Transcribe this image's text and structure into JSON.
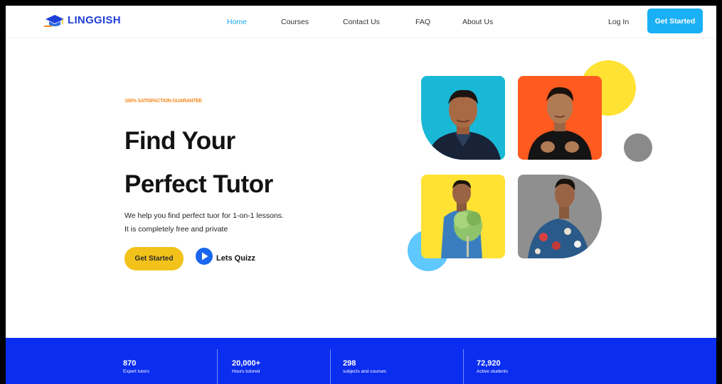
{
  "brand": {
    "name": "LINGGISH",
    "accent": "#1ab0f5",
    "primary": "#0a2df0",
    "yellow": "#f2c21b",
    "orange": "#f5891f"
  },
  "nav": {
    "links": [
      "Home",
      "Courses",
      "Contact Us",
      "FAQ",
      "About Us"
    ],
    "active": "Home",
    "login": "Log In",
    "cta": "Get Started"
  },
  "hero": {
    "eyebrow": "100% SATISFACTION GUARANTEE",
    "headline_1": "Find Your",
    "headline_2": "Perfect Tutor",
    "desc_1": "We help you find perfect tuor for 1-on-1 lessons.",
    "desc_2": "It is completely free and private",
    "cta": "Get Started",
    "secondary": "Lets Quizz",
    "secondary_icon": "play-icon"
  },
  "gallery": {
    "tiles": [
      {
        "bg": "#19b8d6",
        "shape": "photo-tutor-1"
      },
      {
        "bg": "#ff5a1f",
        "shape": "photo-tutor-2"
      },
      {
        "bg": "#ffe234",
        "shape": "photo-tutor-3"
      },
      {
        "bg": "#8f8f8f",
        "shape": "photo-tutor-4"
      }
    ],
    "decorations": [
      {
        "color": "#ffe234",
        "name": "yellow-circle"
      },
      {
        "color": "#8a8a8a",
        "name": "gray-circle"
      },
      {
        "color": "#5ec8ff",
        "name": "blue-circle"
      }
    ]
  },
  "stats": [
    {
      "value": "870",
      "label": "Expert tutors"
    },
    {
      "value": "20,000+",
      "label": "Hours tutored"
    },
    {
      "value": "298",
      "label": "subjects and courses"
    },
    {
      "value": "72,920",
      "label": "Active students"
    }
  ]
}
